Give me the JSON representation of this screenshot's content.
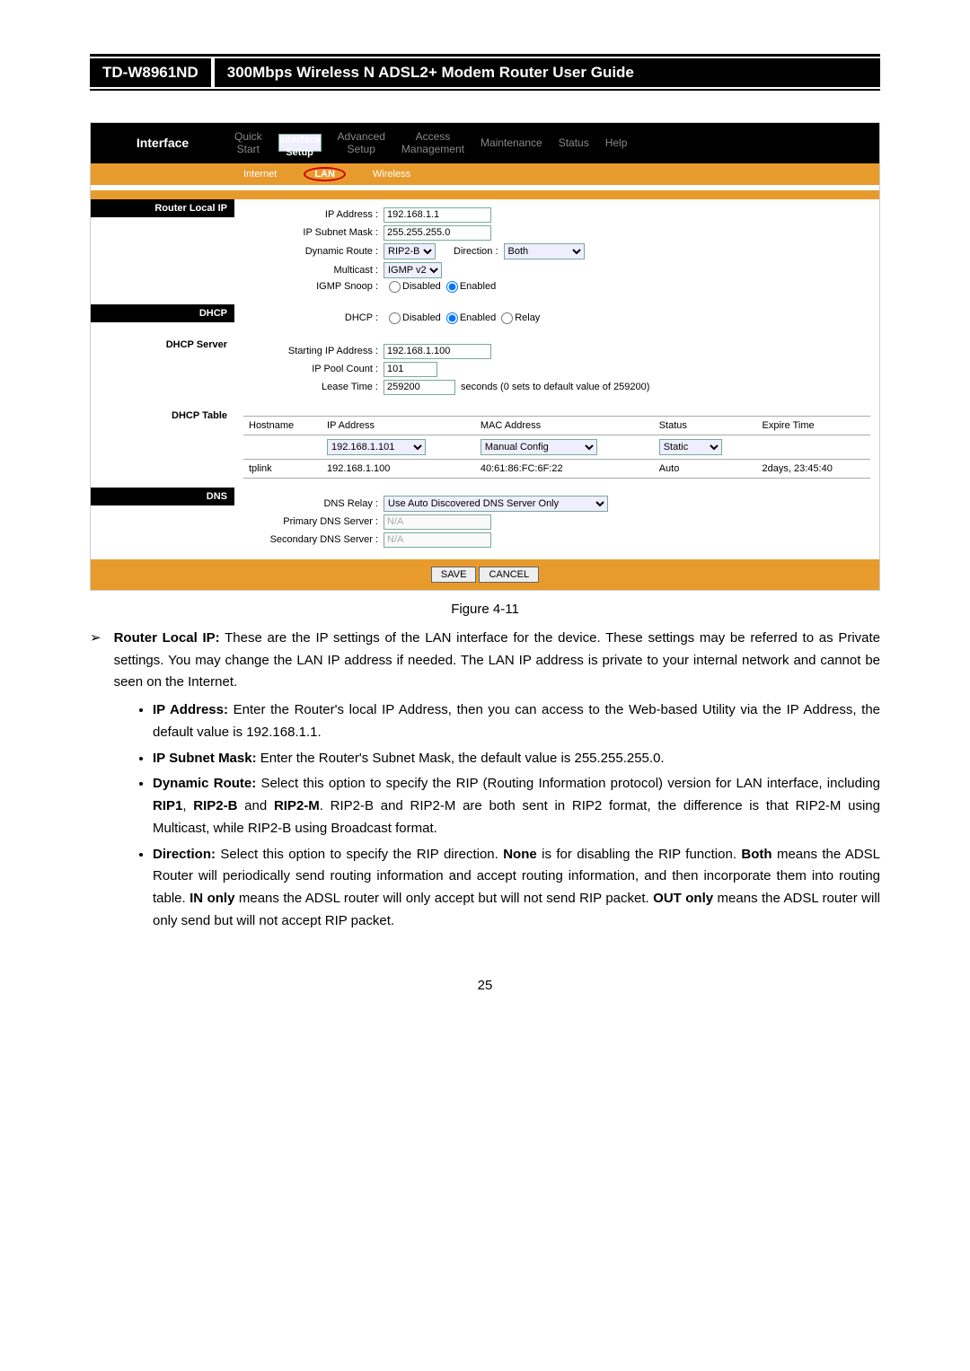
{
  "header": {
    "model": "TD-W8961ND",
    "title": "300Mbps Wireless N ADSL2+ Modem Router User Guide"
  },
  "nav": {
    "side": "Interface",
    "tabs": [
      "Quick\nStart",
      "Interface\nSetup",
      "Advanced\nSetup",
      "Access\nManagement",
      "Maintenance",
      "Status",
      "Help"
    ],
    "sub": [
      "Internet",
      "LAN",
      "Wireless"
    ]
  },
  "sections": {
    "routerLocalIP": {
      "title": "Router Local IP",
      "ip_label": "IP Address :",
      "ip": "192.168.1.1",
      "mask_label": "IP Subnet Mask :",
      "mask": "255.255.255.0",
      "dyn_label": "Dynamic Route :",
      "dyn": "RIP2-B",
      "dir_label": "Direction :",
      "dir": "Both",
      "mc_label": "Multicast :",
      "mc": "IGMP v2",
      "snoop_label": "IGMP Snoop :",
      "snoop_disabled": "Disabled",
      "snoop_enabled": "Enabled"
    },
    "dhcp": {
      "title": "DHCP",
      "label": "DHCP :",
      "opt_disabled": "Disabled",
      "opt_enabled": "Enabled",
      "opt_relay": "Relay"
    },
    "dhcpServer": {
      "title": "DHCP Server",
      "start_label": "Starting IP Address :",
      "start": "192.168.1.100",
      "pool_label": "IP Pool Count :",
      "pool": "101",
      "lease_label": "Lease Time :",
      "lease": "259200",
      "lease_note": "seconds  (0 sets to default value of 259200)"
    },
    "dhcpTable": {
      "title": "DHCP Table",
      "cols": [
        "Hostname",
        "IP Address",
        "MAC Address",
        "Status",
        "Expire Time"
      ],
      "row1": {
        "ip": "192.168.1.101",
        "mac": "Manual Config",
        "status": "Static"
      },
      "row2": {
        "host": "tplink",
        "ip": "192.168.1.100",
        "mac": "40:61:86:FC:6F:22",
        "status": "Auto",
        "exp": "2days, 23:45:40"
      }
    },
    "dns": {
      "title": "DNS",
      "relay_label": "DNS Relay :",
      "relay": "Use Auto Discovered DNS Server Only",
      "primary_label": "Primary DNS Server :",
      "primary": "N/A",
      "secondary_label": "Secondary DNS Server :",
      "secondary": "N/A"
    }
  },
  "buttons": {
    "save": "SAVE",
    "cancel": "CANCEL"
  },
  "figure": "Figure 4-11",
  "doc": {
    "lead_b": "Router Local IP:",
    "lead": " These are the IP settings of the LAN interface for the device. These settings may be referred to as Private settings. You may change the LAN IP address if needed. The LAN IP address is private to your internal network and cannot be seen on the Internet.",
    "b1_b": "IP Address:",
    "b1": " Enter the Router's local IP Address, then you can access to the Web-based Utility via the IP Address, the default value is 192.168.1.1.",
    "b2_b": "IP Subnet Mask:",
    "b2": " Enter the Router's Subnet Mask, the default value is 255.255.255.0.",
    "b3_b": "Dynamic Route:",
    "b3_a": " Select this option to specify the RIP (Routing Information protocol) version for LAN interface, including ",
    "b3_r1": "RIP1",
    "b3_c1": ", ",
    "b3_r2": "RIP2-B",
    "b3_c2": " and ",
    "b3_r3": "RIP2-M",
    "b3_t": ". RIP2-B and RIP2-M are both sent in RIP2 format, the difference is that RIP2-M using Multicast, while RIP2-B using Broadcast format.",
    "b4_b": "Direction:",
    "b4_a": " Select this option to specify the RIP direction. ",
    "b4_n": "None",
    "b4_b2": " is for disabling the RIP function. ",
    "b4_bo": "Both",
    "b4_c": " means the ADSL Router will periodically send routing information and accept routing information, and then incorporate them into routing table. ",
    "b4_in": "IN only",
    "b4_d": " means the ADSL router will only accept but will not send RIP packet. ",
    "b4_out": "OUT only",
    "b4_e": " means the ADSL router will only send but will not accept RIP packet."
  },
  "pagenum": "25"
}
